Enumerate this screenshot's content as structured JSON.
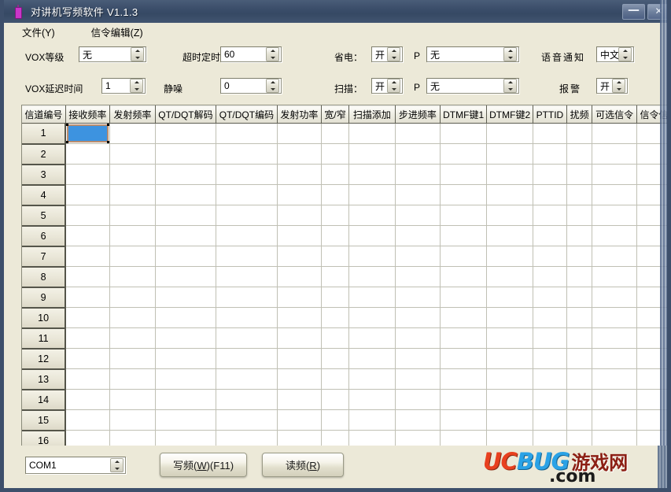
{
  "window": {
    "title": "对讲机写频软件 V1.1.3",
    "icon": "walkie-talkie-icon",
    "minimize_label": "—",
    "close_label": "✕"
  },
  "menubar": {
    "items": [
      {
        "label": "文件(Y)",
        "accel": "Y"
      },
      {
        "label": "信令编辑(Z)",
        "accel": "Z"
      }
    ]
  },
  "settings": {
    "vox_level": {
      "label": "VOX等级",
      "value": "无"
    },
    "vox_delay": {
      "label": "VOX延迟时间",
      "value": "1"
    },
    "timeout_timer": {
      "label": "超时定时器",
      "value": "60"
    },
    "squelch": {
      "label": "静噪",
      "value": "0"
    },
    "power_save": {
      "label": "省电：",
      "value": "开"
    },
    "scan": {
      "label": "扫描：",
      "value": "开"
    },
    "p1": {
      "label": "P",
      "value": "无"
    },
    "p2": {
      "label": "P",
      "value": "无"
    },
    "voice_prompt": {
      "label": "语音通知",
      "value": "中文"
    },
    "alarm": {
      "label": "报警",
      "value": "开"
    }
  },
  "grid": {
    "columns": [
      "信道编号",
      "接收频率",
      "发射频率",
      "QT/DQT解码",
      "QT/DQT编码",
      "发射功率",
      "宽/窄",
      "扫描添加",
      "步进频率",
      "DTMF键1",
      "DTMF键2",
      "PTTID",
      "扰频",
      "可选信令",
      "信令信"
    ],
    "rows": [
      {
        "num": "1",
        "cells": [
          "",
          "",
          "",
          "",
          "",
          "",
          "",
          "",
          "",
          "",
          "",
          "",
          "",
          ""
        ]
      },
      {
        "num": "2",
        "cells": [
          "",
          "",
          "",
          "",
          "",
          "",
          "",
          "",
          "",
          "",
          "",
          "",
          "",
          ""
        ]
      },
      {
        "num": "3",
        "cells": [
          "",
          "",
          "",
          "",
          "",
          "",
          "",
          "",
          "",
          "",
          "",
          "",
          "",
          ""
        ]
      },
      {
        "num": "4",
        "cells": [
          "",
          "",
          "",
          "",
          "",
          "",
          "",
          "",
          "",
          "",
          "",
          "",
          "",
          ""
        ]
      },
      {
        "num": "5",
        "cells": [
          "",
          "",
          "",
          "",
          "",
          "",
          "",
          "",
          "",
          "",
          "",
          "",
          "",
          ""
        ]
      },
      {
        "num": "6",
        "cells": [
          "",
          "",
          "",
          "",
          "",
          "",
          "",
          "",
          "",
          "",
          "",
          "",
          "",
          ""
        ]
      },
      {
        "num": "7",
        "cells": [
          "",
          "",
          "",
          "",
          "",
          "",
          "",
          "",
          "",
          "",
          "",
          "",
          "",
          ""
        ]
      },
      {
        "num": "8",
        "cells": [
          "",
          "",
          "",
          "",
          "",
          "",
          "",
          "",
          "",
          "",
          "",
          "",
          "",
          ""
        ]
      },
      {
        "num": "9",
        "cells": [
          "",
          "",
          "",
          "",
          "",
          "",
          "",
          "",
          "",
          "",
          "",
          "",
          "",
          ""
        ]
      },
      {
        "num": "10",
        "cells": [
          "",
          "",
          "",
          "",
          "",
          "",
          "",
          "",
          "",
          "",
          "",
          "",
          "",
          ""
        ]
      },
      {
        "num": "11",
        "cells": [
          "",
          "",
          "",
          "",
          "",
          "",
          "",
          "",
          "",
          "",
          "",
          "",
          "",
          ""
        ]
      },
      {
        "num": "12",
        "cells": [
          "",
          "",
          "",
          "",
          "",
          "",
          "",
          "",
          "",
          "",
          "",
          "",
          "",
          ""
        ]
      },
      {
        "num": "13",
        "cells": [
          "",
          "",
          "",
          "",
          "",
          "",
          "",
          "",
          "",
          "",
          "",
          "",
          "",
          ""
        ]
      },
      {
        "num": "14",
        "cells": [
          "",
          "",
          "",
          "",
          "",
          "",
          "",
          "",
          "",
          "",
          "",
          "",
          "",
          ""
        ]
      },
      {
        "num": "15",
        "cells": [
          "",
          "",
          "",
          "",
          "",
          "",
          "",
          "",
          "",
          "",
          "",
          "",
          "",
          ""
        ]
      },
      {
        "num": "16",
        "cells": [
          "",
          "",
          "",
          "",
          "",
          "",
          "",
          "",
          "",
          "",
          "",
          "",
          "",
          ""
        ]
      }
    ],
    "selected_cell": {
      "row": 1,
      "column": "接收频率",
      "value": ""
    },
    "selection_color": "#3d93e0",
    "selection_border_color": "#b98d6e"
  },
  "bottombar": {
    "port": {
      "label": "COM1",
      "value": "COM1"
    },
    "write_button": {
      "label": "写频(W)(F11)",
      "pre": "写频(",
      "accel": "W",
      "post": ")(F11)"
    },
    "read_button": {
      "label": "读频(R)",
      "pre": "读频(",
      "accel": "R",
      "post": ")"
    }
  },
  "watermark": {
    "uc": "UC",
    "bug": "BUG",
    "cn": "游戏网",
    "domain": ".com",
    "uc_color": "#e8401f",
    "bug_color": "#2aa2e6",
    "cn_color": "#8c1f14"
  }
}
